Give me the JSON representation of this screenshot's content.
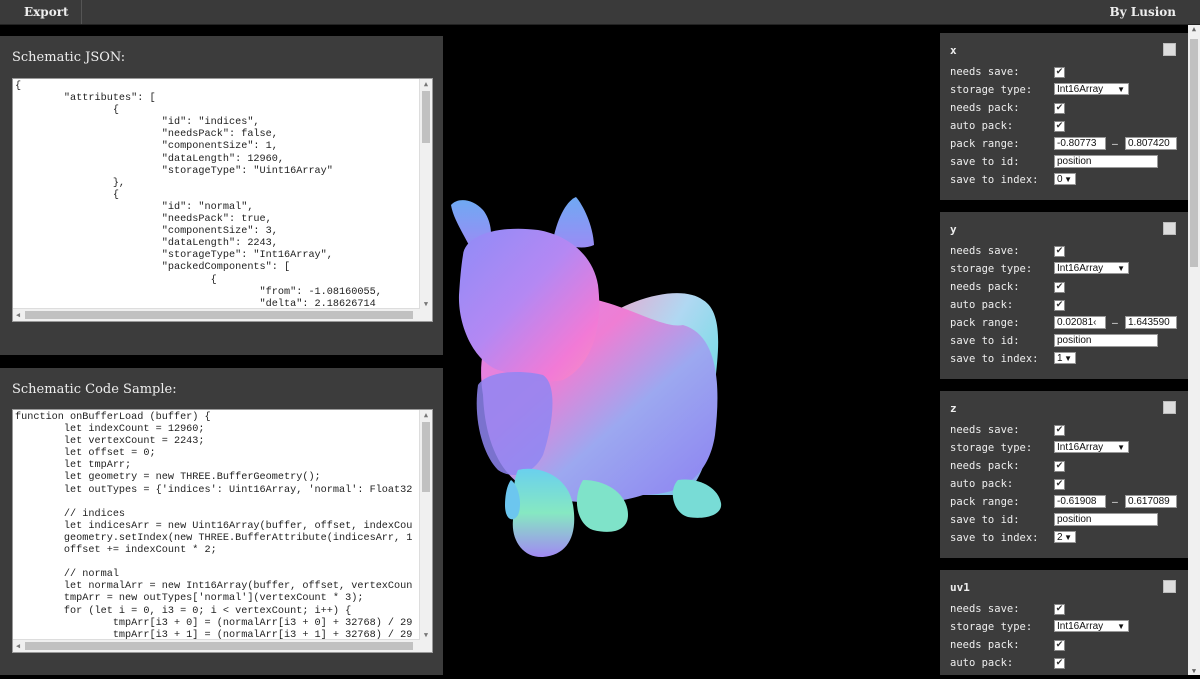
{
  "topbar": {
    "export_label": "Export",
    "byline": "By Lusion"
  },
  "json_panel": {
    "title": "Schematic JSON:",
    "code": "{\n        \"attributes\": [\n                {\n                        \"id\": \"indices\",\n                        \"needsPack\": false,\n                        \"componentSize\": 1,\n                        \"dataLength\": 12960,\n                        \"storageType\": \"Uint16Array\"\n                },\n                {\n                        \"id\": \"normal\",\n                        \"needsPack\": true,\n                        \"componentSize\": 3,\n                        \"dataLength\": 2243,\n                        \"storageType\": \"Int16Array\",\n                        \"packedComponents\": [\n                                {\n                                        \"from\": -1.08160055,\n                                        \"delta\": 2.18626714"
  },
  "code_panel": {
    "title": "Schematic Code Sample:",
    "code": "function onBufferLoad (buffer) {\n        let indexCount = 12960;\n        let vertexCount = 2243;\n        let offset = 0;\n        let tmpArr;\n        let geometry = new THREE.BufferGeometry();\n        let outTypes = {'indices': Uint16Array, 'normal': Float32\n\n        // indices\n        let indicesArr = new Uint16Array(buffer, offset, indexCou\n        geometry.setIndex(new THREE.BufferAttribute(indicesArr, 1\n        offset += indexCount * 2;\n\n        // normal\n        let normalArr = new Int16Array(buffer, offset, vertexCoun\n        tmpArr = new outTypes['normal'](vertexCount * 3);\n        for (let i = 0, i3 = 0; i < vertexCount; i++) {\n                tmpArr[i3 + 0] = (normalArr[i3 + 0] + 32768) / 29\n                tmpArr[i3 + 1] = (normalArr[i3 + 1] + 32768) / 29"
  },
  "labels": {
    "needs_save": "needs save:",
    "storage_type": "storage type:",
    "needs_pack": "needs pack:",
    "auto_pack": "auto pack:",
    "pack_range": "pack range:",
    "save_to_id": "save to id:",
    "save_to_index": "save to index:",
    "range_sep": "–",
    "check": "✔",
    "caret": "▼"
  },
  "attributes": [
    {
      "name": "x",
      "storage_type": "Int16Array",
      "range_from": "-0.80773",
      "range_to": "0.807420",
      "save_id": "position",
      "save_index": "0"
    },
    {
      "name": "y",
      "storage_type": "Int16Array",
      "range_from": "0.02081‹",
      "range_to": "1.643590",
      "save_id": "position",
      "save_index": "1"
    },
    {
      "name": "z",
      "storage_type": "Int16Array",
      "range_from": "-0.61908",
      "range_to": "0.617089",
      "save_id": "position",
      "save_index": "2"
    },
    {
      "name": "uv1",
      "storage_type": "Int16Array"
    }
  ],
  "model": {
    "name": "bunny-normal-shaded-mesh",
    "colors": {
      "pink": "#f07ad2",
      "violet": "#9b7cf5",
      "blue": "#6f8ef5",
      "cyan": "#6cd6ea",
      "green": "#7ae8a6"
    }
  }
}
